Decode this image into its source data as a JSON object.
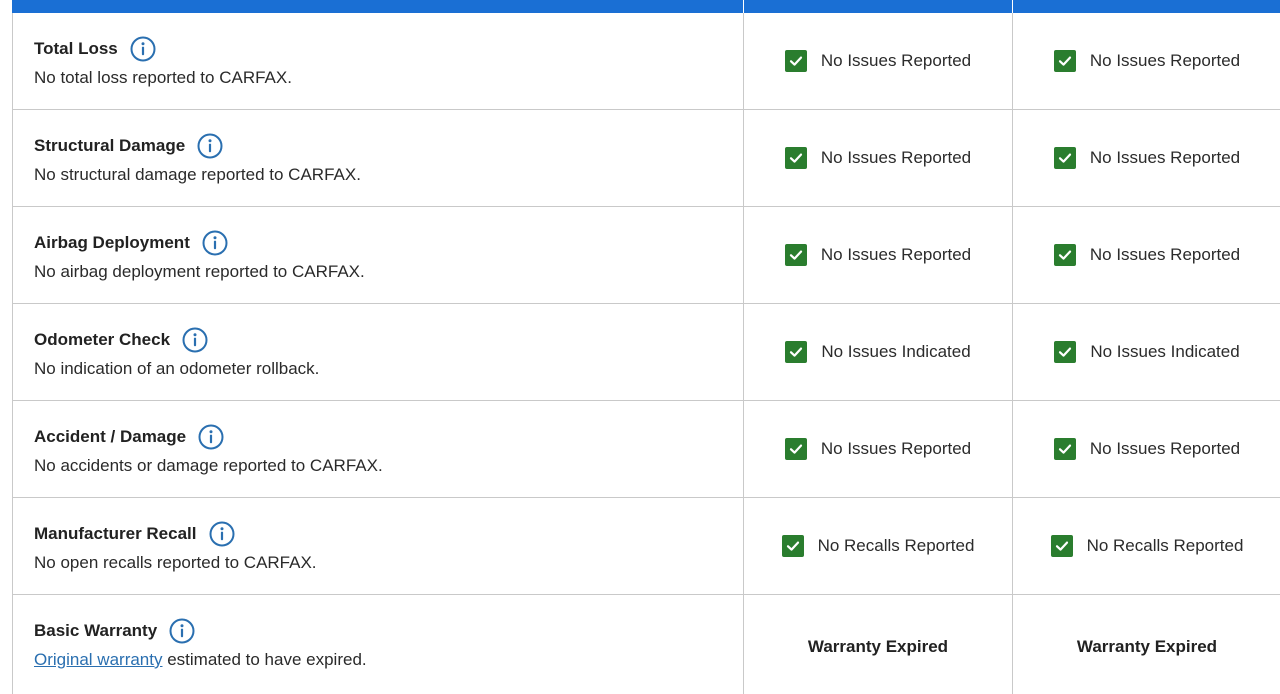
{
  "colors": {
    "header_bar": "#1a6fd4",
    "check_green": "#2a7d2e",
    "info_blue": "#2a6fb0",
    "link_blue": "#2a6fb0",
    "border": "#c9c9c9"
  },
  "rows": [
    {
      "title": "Total Loss",
      "description": "No total loss reported to CARFAX.",
      "vehicle_1_status": "No Issues Reported",
      "vehicle_2_status": "No Issues Reported"
    },
    {
      "title": "Structural Damage",
      "description": "No structural damage reported to CARFAX.",
      "vehicle_1_status": "No Issues Reported",
      "vehicle_2_status": "No Issues Reported"
    },
    {
      "title": "Airbag Deployment",
      "description": "No airbag deployment reported to CARFAX.",
      "vehicle_1_status": "No Issues Reported",
      "vehicle_2_status": "No Issues Reported"
    },
    {
      "title": "Odometer Check",
      "description": "No indication of an odometer rollback.",
      "vehicle_1_status": "No Issues Indicated",
      "vehicle_2_status": "No Issues Indicated"
    },
    {
      "title": "Accident / Damage",
      "description": "No accidents or damage reported to CARFAX.",
      "vehicle_1_status": "No Issues Reported",
      "vehicle_2_status": "No Issues Reported"
    },
    {
      "title": "Manufacturer Recall",
      "description": "No open recalls reported to CARFAX.",
      "vehicle_1_status": "No Recalls Reported",
      "vehicle_2_status": "No Recalls Reported"
    }
  ],
  "warranty_row": {
    "title": "Basic Warranty",
    "description_link": "Original warranty",
    "description_rest": " estimated to have expired.",
    "vehicle_1_status": "Warranty Expired",
    "vehicle_2_status": "Warranty Expired"
  },
  "icons": {
    "info": "info-circle-icon",
    "check": "green-checkbox-icon"
  }
}
